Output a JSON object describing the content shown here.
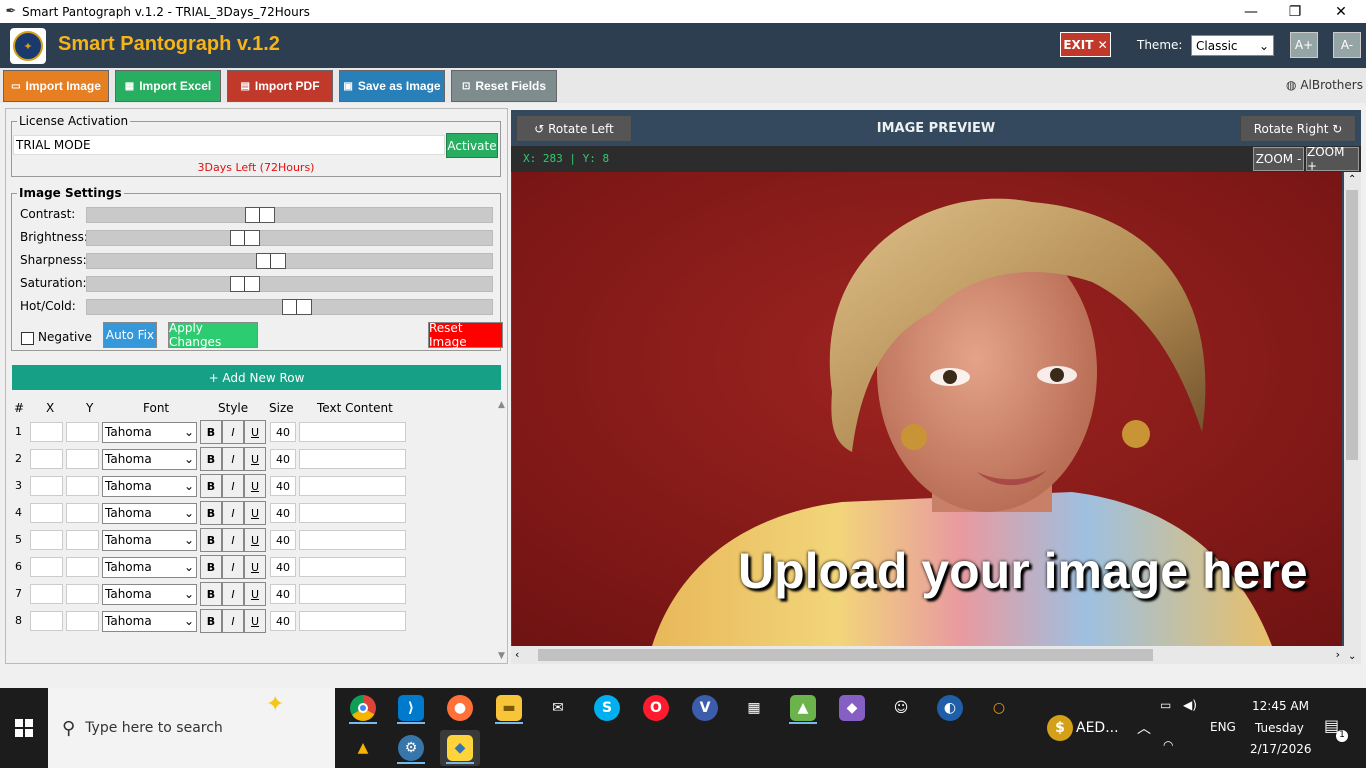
{
  "window": {
    "title": "Smart Pantograph v.1.2 - TRIAL_3Days_72Hours",
    "minimize": "—",
    "restore": "❐",
    "close": "✕"
  },
  "header": {
    "app_title": "Smart Pantograph v.1.2",
    "exit_label": "EXIT ✕",
    "theme_label": "Theme:",
    "theme_value": "Classic",
    "font_increase": "A+",
    "font_decrease": "A-"
  },
  "toolbar": {
    "import_image": "Import Image",
    "import_excel": "Import Excel",
    "import_pdf": "Import PDF",
    "save_image": "Save as Image",
    "reset_fields": "Reset Fields",
    "brand": "AlBrothers",
    "colors": {
      "import_image": "#e67e22",
      "import_excel": "#27ae60",
      "import_pdf": "#c0392b",
      "save_image": "#2980b9",
      "reset_fields": "#7f8c8d"
    }
  },
  "license": {
    "legend": "License Activation",
    "input_value": "TRIAL MODE",
    "activate_label": "Activate",
    "days_left": "3Days Left (72Hours)"
  },
  "image_settings": {
    "legend": "Image Settings",
    "sliders": [
      {
        "label": "Contrast:",
        "value": 0.42
      },
      {
        "label": "Brightness:",
        "value": 0.38
      },
      {
        "label": "Sharpness:",
        "value": 0.45
      },
      {
        "label": "Saturation:",
        "value": 0.38
      },
      {
        "label": "Hot/Cold:",
        "value": 0.52
      }
    ],
    "negative_label": "Negative",
    "negative_checked": false,
    "auto_fix": "Auto Fix",
    "apply_changes": "Apply Changes",
    "reset_image": "Reset Image"
  },
  "rows": {
    "add_label": "+ Add New Row",
    "headers": {
      "num": "#",
      "x": "X",
      "y": "Y",
      "font": "Font",
      "style": "Style",
      "size": "Size",
      "text": "Text Content"
    },
    "style_bold": "B",
    "style_italic": "I",
    "style_underline": "U",
    "items": [
      {
        "num": "1",
        "x": "",
        "y": "",
        "font": "Tahoma",
        "size": "40",
        "text": ""
      },
      {
        "num": "2",
        "x": "",
        "y": "",
        "font": "Tahoma",
        "size": "40",
        "text": ""
      },
      {
        "num": "3",
        "x": "",
        "y": "",
        "font": "Tahoma",
        "size": "40",
        "text": ""
      },
      {
        "num": "4",
        "x": "",
        "y": "",
        "font": "Tahoma",
        "size": "40",
        "text": ""
      },
      {
        "num": "5",
        "x": "",
        "y": "",
        "font": "Tahoma",
        "size": "40",
        "text": ""
      },
      {
        "num": "6",
        "x": "",
        "y": "",
        "font": "Tahoma",
        "size": "40",
        "text": ""
      },
      {
        "num": "7",
        "x": "",
        "y": "",
        "font": "Tahoma",
        "size": "40",
        "text": ""
      },
      {
        "num": "8",
        "x": "",
        "y": "",
        "font": "Tahoma",
        "size": "40",
        "text": ""
      }
    ]
  },
  "preview": {
    "rotate_left": "↺ Rotate Left",
    "title": "IMAGE PREVIEW",
    "rotate_right": "Rotate Right ↻",
    "coords": "X: 283 | Y: 8",
    "zoom_out": "ZOOM -",
    "zoom_in": "ZOOM +",
    "overlay_text": "Upload your image here"
  },
  "taskbar": {
    "search_placeholder": "Type here to search",
    "tray_app": "AED...",
    "lang": "ENG",
    "time": "12:45 AM",
    "day": "Tuesday",
    "date": "2/17/2026",
    "notif_count": "1"
  }
}
